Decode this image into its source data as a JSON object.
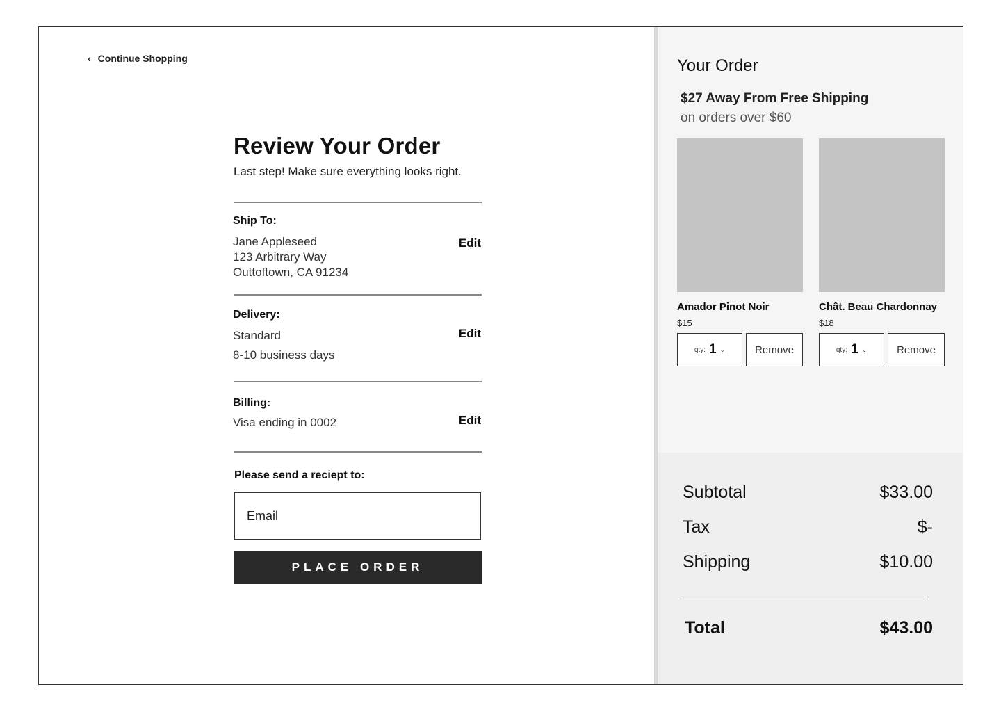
{
  "nav": {
    "back_label": "Continue Shopping"
  },
  "review": {
    "title": "Review Your Order",
    "subtitle": "Last step! Make sure everything looks right.",
    "ship_to": {
      "label": "Ship To:",
      "name": "Jane Appleseed",
      "street": "123 Arbitrary Way",
      "city": "Outtoftown, CA 91234",
      "edit_label": "Edit"
    },
    "delivery": {
      "label": "Delivery:",
      "method": "Standard",
      "time": "8-10 business days",
      "edit_label": "Edit"
    },
    "billing": {
      "label": "Billing:",
      "card": "Visa ending in 0002",
      "edit_label": "Edit"
    },
    "receipt": {
      "label": "Please send a reciept to:",
      "email_placeholder": "Email",
      "email_value": ""
    },
    "place_order_label": "PLACE ORDER"
  },
  "order": {
    "title": "Your Order",
    "free_shipping_msg": "$27 Away From Free Shipping",
    "free_shipping_sub": "on orders over $60",
    "items": [
      {
        "name": "Amador Pinot Noir",
        "price": "$15",
        "qty_label": "qty:",
        "qty": "1",
        "remove_label": "Remove"
      },
      {
        "name": "Chât. Beau Chardonnay",
        "price": "$18",
        "qty_label": "qty:",
        "qty": "1",
        "remove_label": "Remove"
      }
    ]
  },
  "summary": {
    "subtotal_label": "Subtotal",
    "subtotal_value": "$33.00",
    "tax_label": "Tax",
    "tax_value": "$-",
    "shipping_label": "Shipping",
    "shipping_value": "$10.00",
    "total_label": "Total",
    "total_value": "$43.00"
  },
  "icons": {
    "back": "chevron-left-icon",
    "qty_dropdown": "chevron-down-icon"
  },
  "colors": {
    "button_bg": "#2a2a2a",
    "panel_bg": "#f5f5f5",
    "summary_bg": "#efefef",
    "image_placeholder": "#c4c4c4"
  }
}
